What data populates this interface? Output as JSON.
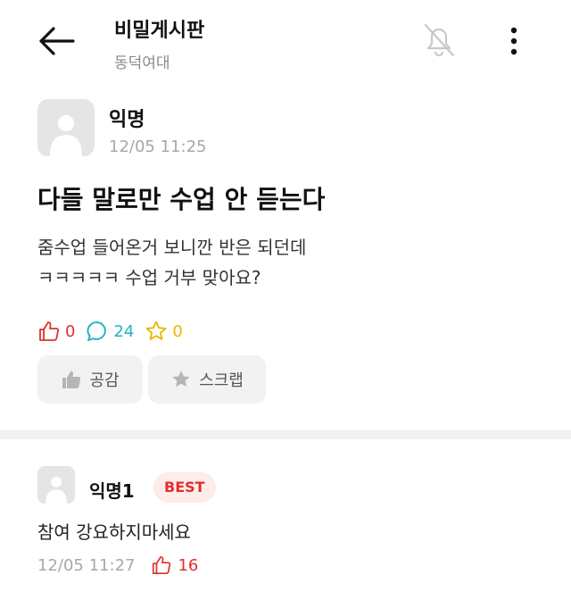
{
  "header": {
    "title": "비밀게시판",
    "subtitle": "동덕여대",
    "back_icon": "arrow-left-icon",
    "bell_icon": "bell-off-icon",
    "more_icon": "more-vertical-icon"
  },
  "post": {
    "author": "익명",
    "time": "12/05 11:25",
    "title": "다들 말로만 수업 안 듣는다",
    "body_lines": [
      "줌수업 들어온거 보니깐 반은 되던데",
      "ㅋㅋㅋㅋㅋ 수업 거부 맞아요?"
    ],
    "likes": "0",
    "comments": "24",
    "scraps": "0",
    "like_button_label": "공감",
    "scrap_button_label": "스크랩"
  },
  "comment": {
    "author": "익명1",
    "badge": "BEST",
    "text": "참여 강요하지마세요",
    "time": "12/05 11:27",
    "likes": "16"
  },
  "colors": {
    "like": "#e0302a",
    "comment": "#1fb3c4",
    "scrap": "#e6b800",
    "muted": "#a8a8a8",
    "button_bg": "#f2f2f2"
  }
}
